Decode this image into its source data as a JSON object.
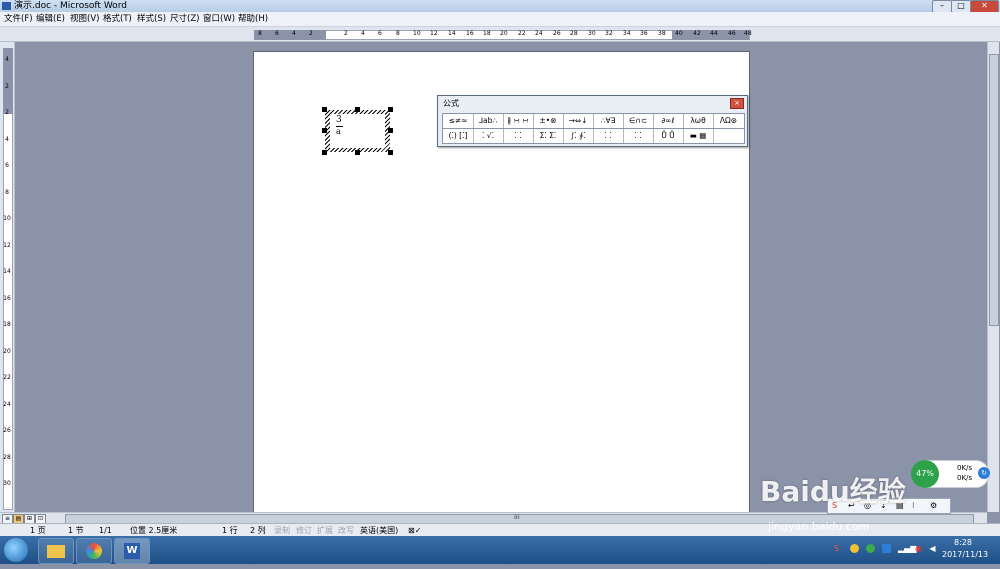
{
  "window": {
    "title": "演示.doc - Microsoft Word",
    "minimize": "–",
    "maximize": "□",
    "close": "✕"
  },
  "menu": [
    "文件(F)",
    "编辑(E)",
    "视图(V)",
    "格式(T)",
    "样式(S)",
    "尺寸(Z)",
    "窗口(W)",
    "帮助(H)"
  ],
  "ruler_h": {
    "corner": "L",
    "ticks": [
      "8",
      "6",
      "4",
      "2",
      "2",
      "4",
      "6",
      "8",
      "10",
      "12",
      "14",
      "16",
      "18",
      "20",
      "22",
      "24",
      "26",
      "28",
      "30",
      "32",
      "34",
      "36",
      "38",
      "40",
      "42",
      "44",
      "46",
      "48"
    ]
  },
  "ruler_v": {
    "ticks": [
      "4",
      "2",
      "2",
      "4",
      "6",
      "8",
      "10",
      "12",
      "14",
      "16",
      "18",
      "20",
      "22",
      "24",
      "26",
      "28",
      "30"
    ]
  },
  "equation": {
    "numerator": "3",
    "denominator": "a"
  },
  "eq_toolbar": {
    "title": "公式",
    "close": "×",
    "row1": [
      "≤≠≈",
      "⅃ab∴",
      "∦ ∺ ∺",
      "±•⊗",
      "→⇔↓",
      "∴∀∃",
      "∈∩⊂",
      "∂∞ℓ",
      "λωθ",
      "ΛΩ⊛"
    ],
    "row2": [
      "(⁚) [⁚]",
      "⁚ √⁚",
      "⁚ ⁚",
      "Σ⁚ Σ⁚",
      "∫⁚ ∮⁚",
      "⁚ ⁚",
      "⁚ ⁚",
      "Ů Ů",
      "▬ ▦"
    ]
  },
  "hscroll": {
    "view_buttons": [
      "≡",
      "▤",
      "⊞",
      "⊡"
    ],
    "grip": "⁞⁞⁞"
  },
  "status": {
    "page": "1 页",
    "section": "1 节",
    "pages": "1/1",
    "position": "位置 2.5厘米",
    "line": "1 行",
    "col": "2 列",
    "rec": "录制",
    "trk": "修订",
    "ext": "扩展",
    "ovr": "改写",
    "lang": "英语(美国)",
    "spell": "⊠✓"
  },
  "taskbar": {
    "time": "8:28",
    "date": "2017/11/13",
    "word_icon": "W"
  },
  "network": {
    "percent": "47%",
    "up": "0K/s",
    "down": "0K/s",
    "arrow": "↻"
  },
  "floatbar": {
    "items": [
      "S",
      "↩",
      "◎",
      "⇣",
      "▤",
      "⁝",
      "⚙"
    ]
  },
  "watermark": {
    "text": "Baidu经验",
    "url": "jingyan.baidu.com"
  }
}
